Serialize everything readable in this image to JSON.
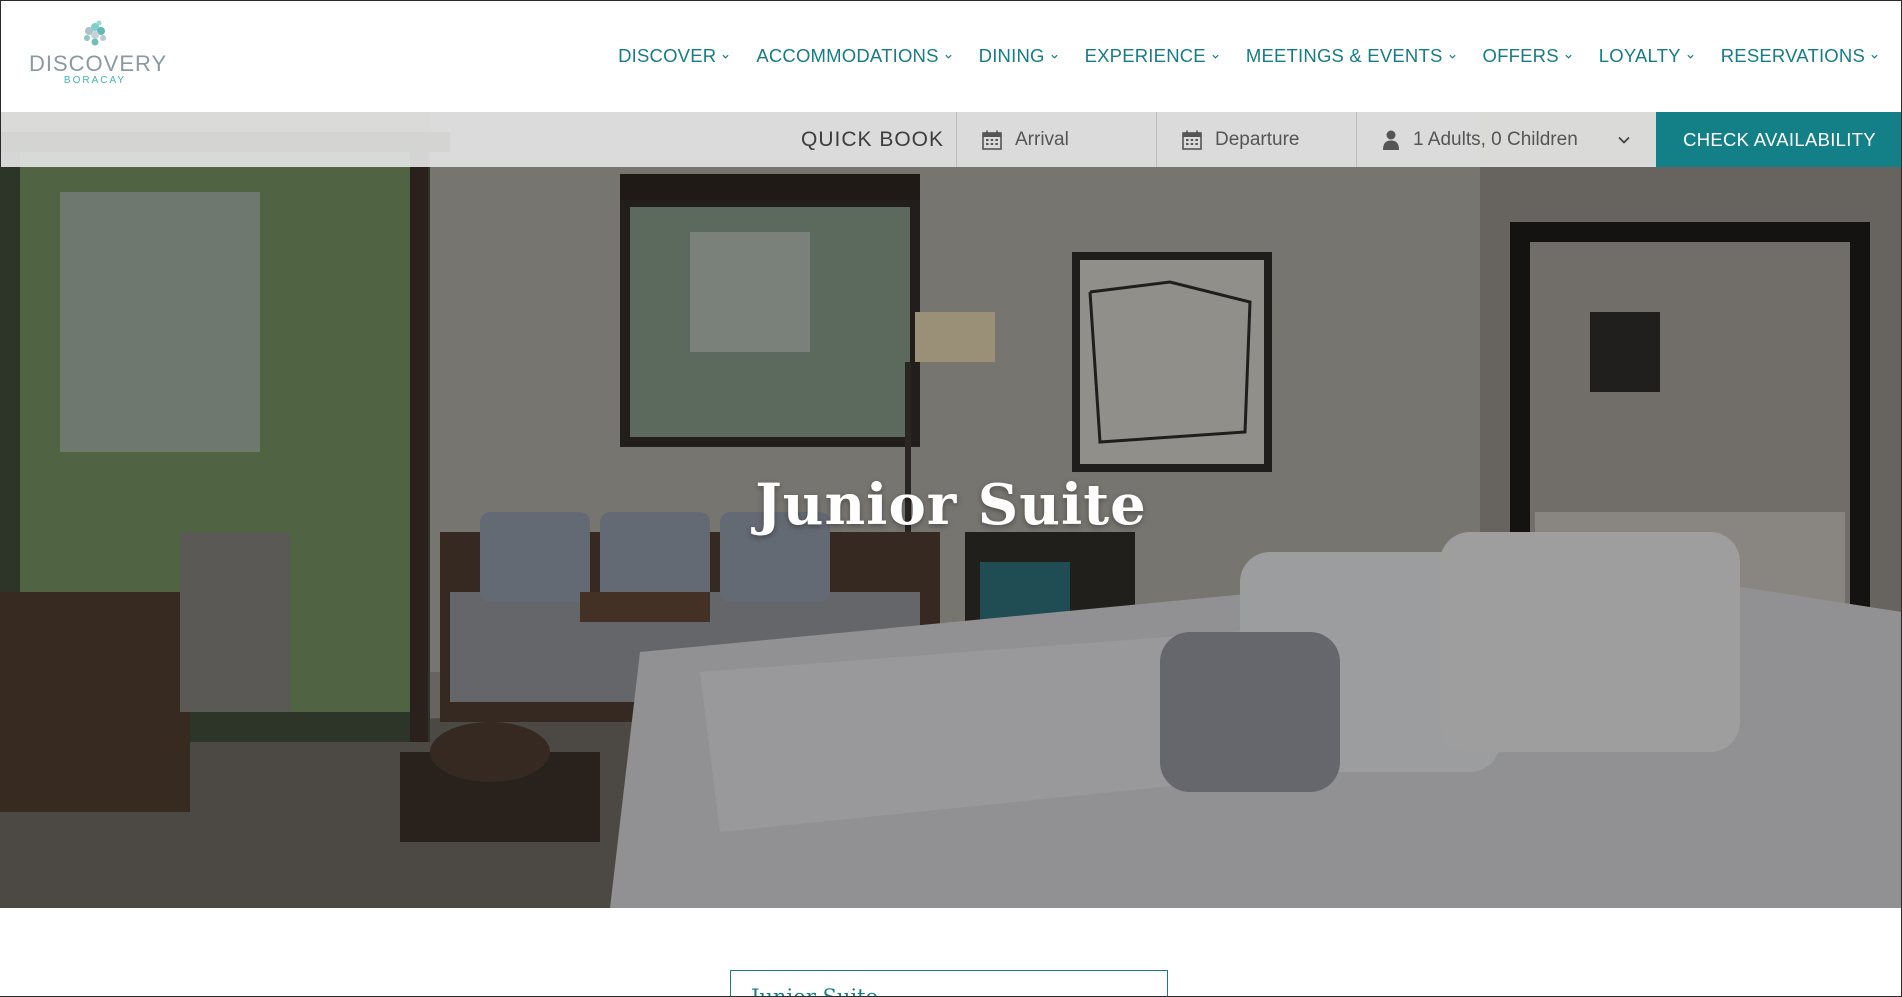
{
  "brand": {
    "name": "DISCOVERY",
    "location": "BORACAY"
  },
  "nav": {
    "items": [
      {
        "label": "DISCOVER",
        "icon": "chevron-down-icon"
      },
      {
        "label": "ACCOMMODATIONS",
        "icon": "chevron-down-icon"
      },
      {
        "label": "DINING",
        "icon": "chevron-down-icon"
      },
      {
        "label": "EXPERIENCE",
        "icon": "chevron-down-icon"
      },
      {
        "label": "MEETINGS & EVENTS",
        "icon": "chevron-down-icon"
      },
      {
        "label": "OFFERS",
        "icon": "chevron-down-icon"
      },
      {
        "label": "LOYALTY",
        "icon": "chevron-down-icon"
      },
      {
        "label": "RESERVATIONS",
        "icon": "chevron-down-icon"
      }
    ]
  },
  "booking": {
    "label": "QUICK BOOK",
    "arrival_placeholder": "Arrival",
    "departure_placeholder": "Departure",
    "guests_value": "1 Adults, 0 Children",
    "check_label": "CHECK AVAILABILITY",
    "icons": {
      "arrival": "calendar-icon",
      "departure": "calendar-icon",
      "guests": "person-icon",
      "guests_dropdown": "chevron-down-icon"
    }
  },
  "hero": {
    "title": "Junior Suite"
  },
  "content": {
    "tab_title": "Junior Suite"
  },
  "colors": {
    "accent": "#137f86",
    "nav_text": "#167d86",
    "logo_grey": "#8a9aa0",
    "logo_teal": "#3fb6b4"
  }
}
